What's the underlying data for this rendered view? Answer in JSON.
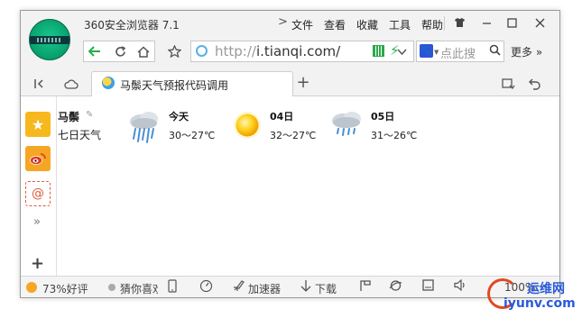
{
  "window": {
    "title": "360安全浏览器 7.1",
    "menu_arrow": ">",
    "menus": [
      "文件",
      "查看",
      "收藏",
      "工具",
      "帮助"
    ]
  },
  "toolbar": {
    "url_prefix": "http://",
    "url_domain": "i.tianqi.com/",
    "search_engine_glyph": "🐾",
    "search_placeholder": "点此搜",
    "more_label": "更多",
    "more_chevron": "»"
  },
  "tabs": {
    "items": [
      {
        "label": "马鬃天气预报代码调用",
        "active": true
      }
    ],
    "add_label": "+"
  },
  "sidebar": {
    "more_chevron": "»",
    "add_label": "+"
  },
  "weather": {
    "location": "马鬃",
    "subtitle": "七日天气",
    "days": [
      {
        "name": "今天",
        "temp": "30～27℃",
        "icon": "rain-cloud-icon"
      },
      {
        "name": "04日",
        "temp": "32～27℃",
        "icon": "sun-icon"
      },
      {
        "name": "05日",
        "temp": "31～26℃",
        "icon": "rain-cloud-icon"
      }
    ]
  },
  "statusbar": {
    "rating": "73%好评",
    "guess": "猜你喜欢",
    "accelerator": "加速器",
    "download": "下载",
    "zoom": "100%"
  },
  "watermark": {
    "top": "运维网",
    "bottom": "iyunv.com"
  },
  "colors": {
    "accent": "#22b04a",
    "brand_blue": "#2a5ad8",
    "star": "#f7b81d"
  }
}
